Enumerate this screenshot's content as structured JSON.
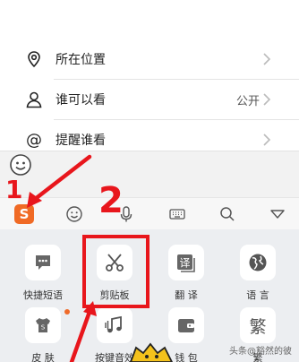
{
  "settings": {
    "location": {
      "label": "所在位置"
    },
    "visibility": {
      "label": "谁可以看",
      "value": "公开"
    },
    "remind": {
      "label": "提醒谁看"
    }
  },
  "keyboard_toolbar": {
    "icons": [
      "sogou-logo-icon",
      "emoji-icon",
      "microphone-icon",
      "keyboard-icon",
      "search-icon",
      "collapse-icon"
    ],
    "sogou_glyph": "S"
  },
  "panel": {
    "tiles": [
      {
        "label": "快捷短语",
        "icon": "quick-phrase-icon"
      },
      {
        "label": "剪贴板",
        "icon": "scissors-icon"
      },
      {
        "label": "翻 译",
        "icon": "translate-icon",
        "glyph": "译"
      },
      {
        "label": "语 言",
        "icon": "globe-icon"
      },
      {
        "label": "皮 肤",
        "icon": "skin-icon"
      },
      {
        "label": "按键音效",
        "icon": "music-icon"
      },
      {
        "label": "钱 包",
        "icon": "wallet-icon"
      },
      {
        "label": "繁",
        "icon": "traditional-icon",
        "glyph": "繁"
      }
    ]
  },
  "annotations": {
    "step1": "1",
    "step2": "2",
    "color": "#e8161c"
  },
  "watermark": "头条@豁然的彼"
}
